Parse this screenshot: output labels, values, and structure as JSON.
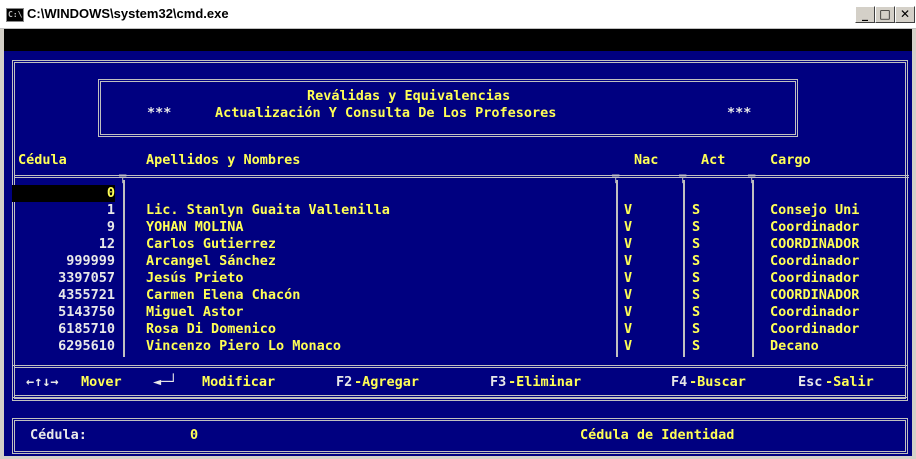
{
  "window": {
    "title": "C:\\WINDOWS\\system32\\cmd.exe",
    "icon_text": "C:\\",
    "minimize": "_",
    "maximize": "□",
    "close": "✕"
  },
  "header": {
    "line1": "Reválidas y Equivalencias",
    "line2_prefix": "***",
    "line2": "Actualización Y Consulta De Los Profesores",
    "line2_suffix": "***"
  },
  "table": {
    "columns": {
      "cedula": "Cédula",
      "nombres": "Apellidos y Nombres",
      "nac": "Nac",
      "act": "Act",
      "cargo": "Cargo"
    },
    "rows": [
      {
        "cedula": "0",
        "nombres": "",
        "nac": "",
        "act": "",
        "cargo": "",
        "selected": true
      },
      {
        "cedula": "1",
        "nombres": "Lic. Stanlyn Guaita Vallenilla",
        "nac": "V",
        "act": "S",
        "cargo": "Consejo Uni"
      },
      {
        "cedula": "9",
        "nombres": "YOHAN MOLINA",
        "nac": "V",
        "act": "S",
        "cargo": "Coordinador"
      },
      {
        "cedula": "12",
        "nombres": "Carlos Gutierrez",
        "nac": "V",
        "act": "S",
        "cargo": "COORDINADOR"
      },
      {
        "cedula": "999999",
        "nombres": "Arcangel Sánchez",
        "nac": "V",
        "act": "S",
        "cargo": "Coordinador"
      },
      {
        "cedula": "3397057",
        "nombres": "Jesús Prieto",
        "nac": "V",
        "act": "S",
        "cargo": "Coordinador"
      },
      {
        "cedula": "4355721",
        "nombres": "Carmen Elena Chacón",
        "nac": "V",
        "act": "S",
        "cargo": "COORDINADOR"
      },
      {
        "cedula": "5143750",
        "nombres": "Miguel Astor",
        "nac": "V",
        "act": "S",
        "cargo": "Coordinador"
      },
      {
        "cedula": "6185710",
        "nombres": "Rosa Di Domenico",
        "nac": "V",
        "act": "S",
        "cargo": "Coordinador"
      },
      {
        "cedula": "6295610",
        "nombres": "Vincenzo Piero Lo Monaco",
        "nac": "V",
        "act": "S",
        "cargo": "Decano"
      }
    ]
  },
  "footer": {
    "mover_keys": "←↑↓→",
    "mover": "Mover",
    "modificar_key": "◄─┘",
    "modificar": "Modificar",
    "agregar_key": "F2",
    "agregar": "-Agregar",
    "eliminar_key": "F3",
    "eliminar": "-Eliminar",
    "buscar_key": "F4",
    "buscar": "-Buscar",
    "salir_key": "Esc",
    "salir": "-Salir"
  },
  "status": {
    "label": "Cédula:",
    "value": "0",
    "hint": "Cédula de Identidad"
  },
  "colors": {
    "console_bg": "#000080",
    "text_highlight": "#ffff55",
    "text_normal": "#e8e8e8",
    "border": "#c0c0c0"
  }
}
